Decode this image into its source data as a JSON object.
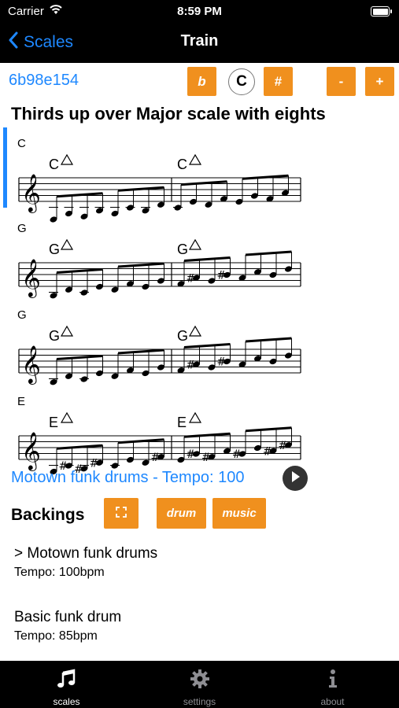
{
  "status": {
    "carrier": "Carrier",
    "time": "8:59 PM"
  },
  "nav": {
    "back_label": "Scales",
    "title": "Train"
  },
  "toolbar": {
    "scale_id": "6b98e154",
    "flat_label": "b",
    "natural_label": "C",
    "sharp_label": "#",
    "minus_label": "-",
    "plus_label": "+"
  },
  "exercise_title": "Thirds up over Major scale with eights",
  "staves": [
    {
      "chord": "C",
      "bar1_chord": "C",
      "bar2_chord": "C"
    },
    {
      "chord": "G",
      "bar1_chord": "G",
      "bar2_chord": "G"
    },
    {
      "chord": "G",
      "bar1_chord": "G",
      "bar2_chord": "G"
    },
    {
      "chord": "E",
      "bar1_chord": "E",
      "bar2_chord": "E"
    }
  ],
  "current_backing_link": "Motown funk drums - Tempo: 100",
  "backings": {
    "title": "Backings",
    "drum_label": "drum",
    "music_label": "music",
    "items": [
      {
        "name": "> Motown funk drums",
        "tempo": "Tempo: 100bpm"
      },
      {
        "name": "Basic funk drum",
        "tempo": "Tempo: 85bpm"
      }
    ]
  },
  "tabs": [
    {
      "label": "scales",
      "icon": "music-note-icon",
      "active": true
    },
    {
      "label": "settings",
      "icon": "gear-icon",
      "active": false
    },
    {
      "label": "about",
      "icon": "info-icon",
      "active": false
    }
  ],
  "colors": {
    "accent": "#1e88ff",
    "button": "#f0901e",
    "bar": "#000000",
    "inactive_tab": "#8e8e93"
  }
}
